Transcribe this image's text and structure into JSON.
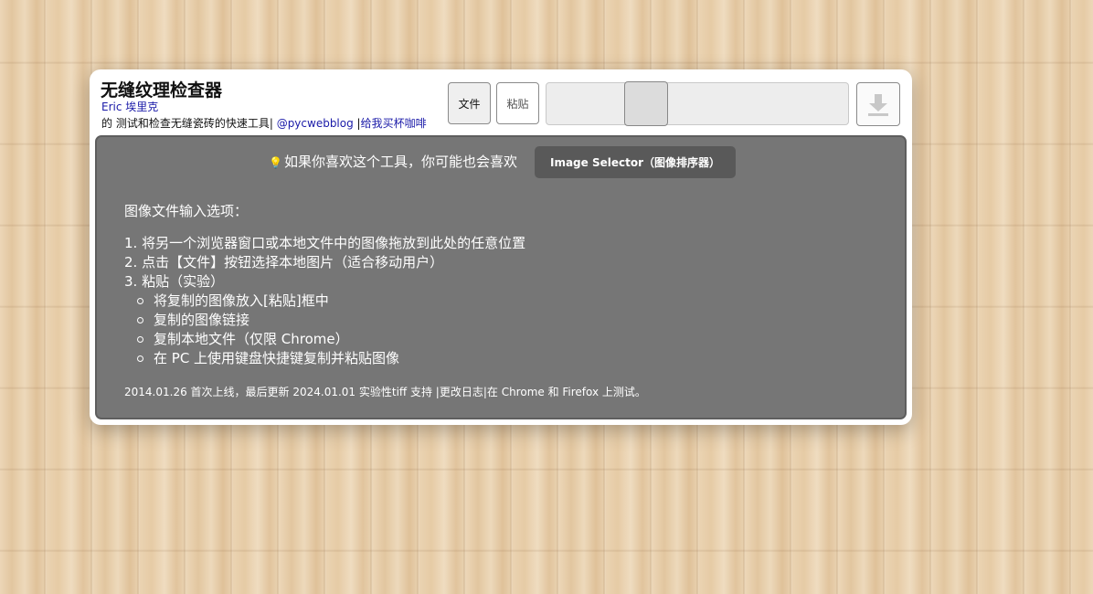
{
  "header": {
    "title": "无缝纹理检查器",
    "author": "Eric 埃里克",
    "desc_prefix": "的 测试和检查无缝瓷砖的快速工具|",
    "twitter_link": "@pycwebblog",
    "separator": " |",
    "coffee_link": "给我买杯咖啡"
  },
  "toolbar": {
    "file_label": "文件",
    "paste_label": "粘贴",
    "slider_value": 0.3,
    "download_icon": "download-icon"
  },
  "panel": {
    "promo_text": "如果你喜欢这个工具，你可能也会喜欢",
    "promo_icon": "lightbulb-icon",
    "promo_button": "Image Selector（图像排序器）",
    "options_heading": "图像文件输入选项：",
    "steps": [
      "1. 将另一个浏览器窗口或本地文件中的图像拖放到此处的任意位置",
      "2. 点击【文件】按钮选择本地图片（适合移动用户）",
      "3. 粘贴（实验）"
    ],
    "paste_substeps": [
      "将复制的图像放入[粘贴]框中",
      "复制的图像链接",
      "复制本地文件（仅限 Chrome）",
      "在 PC 上使用键盘快捷键复制并粘贴图像"
    ],
    "footer_text": "2014.01.26 首次上线，最后更新 2024.01.01 实验性tiff 支持 |更改日志|在 Chrome 和 Firefox 上测试。"
  },
  "colors": {
    "panel_bg": "#767676",
    "link": "#1a1aa8",
    "promo_button_bg": "#595959"
  }
}
